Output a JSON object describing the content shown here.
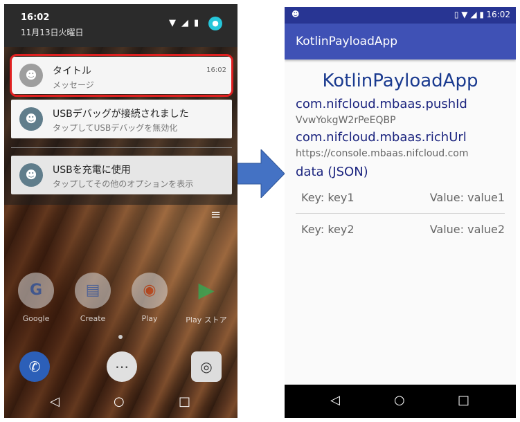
{
  "left": {
    "time": "16:02",
    "date": "11月13日火曜日",
    "notifications": [
      {
        "title": "タイトル",
        "message": "メッセージ",
        "time": "16:02"
      },
      {
        "title": "USBデバッグが接続されました",
        "message": "タップしてUSBデバッグを無効化"
      },
      {
        "title": "USBを充電に使用",
        "message": "タップしてその他のオプションを表示"
      }
    ],
    "apps": [
      {
        "label": "Google",
        "icon": "google-icon"
      },
      {
        "label": "Create",
        "icon": "docs-icon"
      },
      {
        "label": "Play",
        "icon": "play-music-icon"
      },
      {
        "label": "Play ストア",
        "icon": "play-store-icon"
      }
    ],
    "dock": [
      "phone-icon",
      "app-drawer-icon",
      "camera-icon"
    ],
    "nav": {
      "back": "◁",
      "home": "○",
      "recents": "□"
    }
  },
  "right": {
    "status_time": "16:02",
    "app_title": "KotlinPayloadApp",
    "heading": "KotlinPayloadApp",
    "push_id_key": "com.nifcloud.mbaas.pushId",
    "push_id_value": "VvwYokgW2rPeEQBP",
    "rich_url_key": "com.nifcloud.mbaas.richUrl",
    "rich_url_value": "https://console.mbaas.nifcloud.com",
    "data_label": "data (JSON)",
    "rows": [
      {
        "key": "Key: key1",
        "value": "Value: value1"
      },
      {
        "key": "Key: key2",
        "value": "Value: value2"
      }
    ],
    "nav": {
      "back": "◁",
      "home": "○",
      "recents": "□"
    }
  },
  "colors": {
    "status_bar": "#283593",
    "app_bar": "#3f51b5",
    "heading": "#1a3a8f",
    "highlight": "#e02020",
    "arrow": "#4472c4"
  }
}
